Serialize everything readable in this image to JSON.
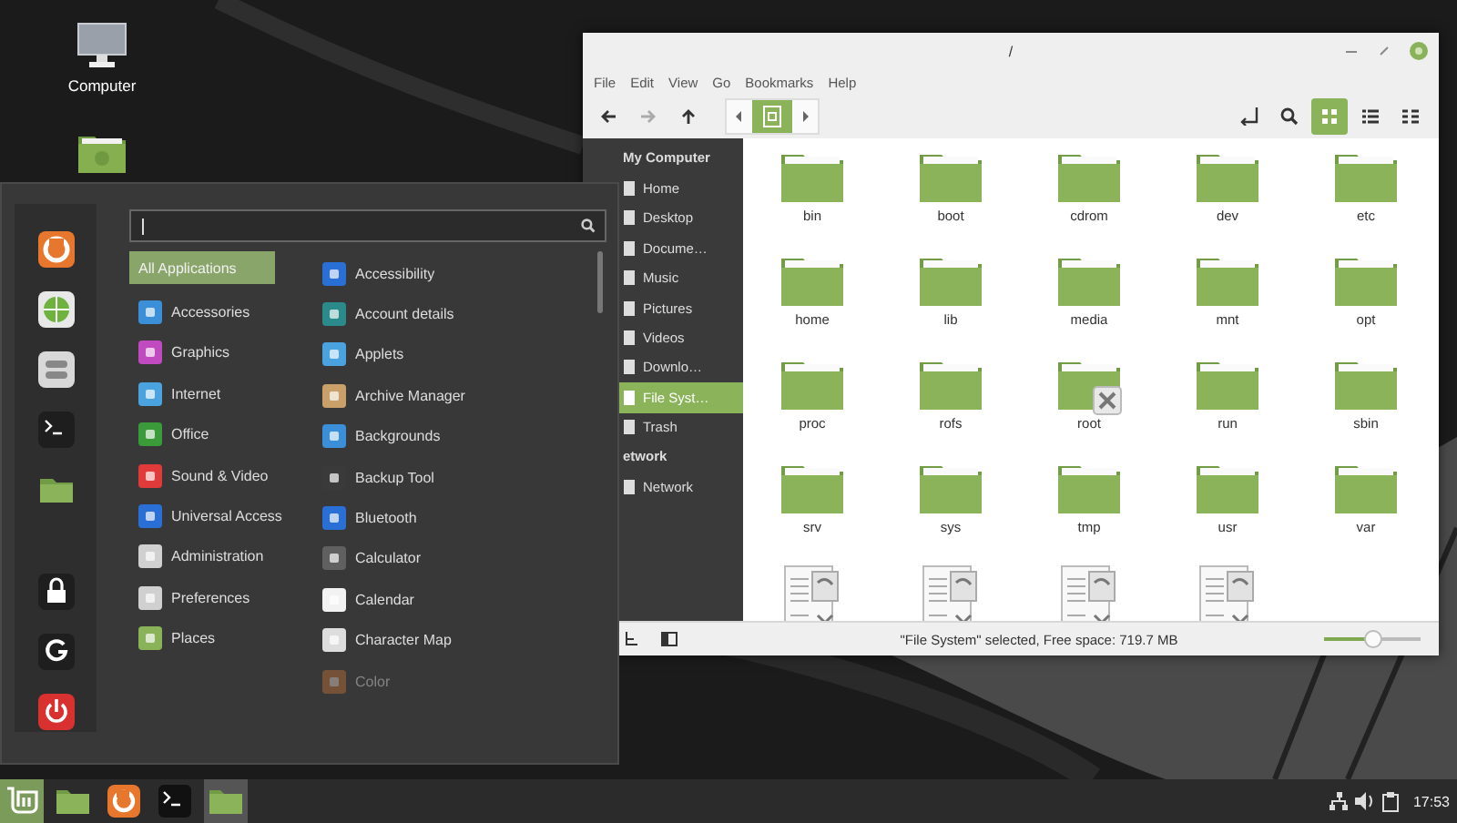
{
  "desktop_icons": [
    {
      "label": "Computer"
    }
  ],
  "file_manager": {
    "title": "/",
    "menu": [
      "File",
      "Edit",
      "View",
      "Go",
      "Bookmarks",
      "Help"
    ],
    "path_buttons": [
      {
        "selected": true
      }
    ],
    "view_modes": [
      {
        "selected": true
      },
      {
        "selected": false
      },
      {
        "selected": false
      }
    ],
    "sidebar": [
      {
        "heading": "My Computer",
        "items": [
          {
            "label": "Home",
            "selected": false
          },
          {
            "label": "Desktop",
            "selected": false
          },
          {
            "label": "Docume…",
            "selected": false
          },
          {
            "label": "Music",
            "selected": false
          },
          {
            "label": "Pictures",
            "selected": false
          },
          {
            "label": "Videos",
            "selected": false
          },
          {
            "label": "Downlo…",
            "selected": false
          },
          {
            "label": "File Syst…",
            "selected": true
          },
          {
            "label": "Trash",
            "selected": false
          }
        ]
      },
      {
        "heading": "etwork",
        "items": [
          {
            "label": "Network",
            "selected": false
          }
        ]
      }
    ],
    "files": [
      {
        "name": "bin",
        "kind": "folder",
        "locked": false
      },
      {
        "name": "boot",
        "kind": "folder",
        "locked": false
      },
      {
        "name": "cdrom",
        "kind": "folder",
        "locked": false
      },
      {
        "name": "dev",
        "kind": "folder",
        "locked": false
      },
      {
        "name": "etc",
        "kind": "folder",
        "locked": false
      },
      {
        "name": "home",
        "kind": "folder",
        "locked": false
      },
      {
        "name": "lib",
        "kind": "folder",
        "locked": false
      },
      {
        "name": "media",
        "kind": "folder",
        "locked": false
      },
      {
        "name": "mnt",
        "kind": "folder",
        "locked": false
      },
      {
        "name": "opt",
        "kind": "folder",
        "locked": false
      },
      {
        "name": "proc",
        "kind": "folder",
        "locked": false
      },
      {
        "name": "rofs",
        "kind": "folder",
        "locked": false
      },
      {
        "name": "root",
        "kind": "folder",
        "locked": true
      },
      {
        "name": "run",
        "kind": "folder",
        "locked": false
      },
      {
        "name": "sbin",
        "kind": "folder",
        "locked": false
      },
      {
        "name": "srv",
        "kind": "folder",
        "locked": false
      },
      {
        "name": "sys",
        "kind": "folder",
        "locked": false
      },
      {
        "name": "tmp",
        "kind": "folder",
        "locked": false
      },
      {
        "name": "usr",
        "kind": "folder",
        "locked": false
      },
      {
        "name": "var",
        "kind": "folder",
        "locked": false
      },
      {
        "kind": "document",
        "locked": false
      },
      {
        "kind": "document",
        "locked": false
      },
      {
        "kind": "document",
        "locked": false
      },
      {
        "kind": "document",
        "locked": false
      }
    ],
    "status_bar": {
      "text": "\"File System\" selected, Free space: 719.7 MB",
      "zoom": {
        "level": 0.5
      }
    }
  },
  "menu": {
    "categories": [
      {
        "label": "All Applications",
        "selected": true
      },
      {
        "label": "Accessories",
        "selected": false
      },
      {
        "label": "Graphics",
        "selected": false
      },
      {
        "label": "Internet",
        "selected": false
      },
      {
        "label": "Office",
        "selected": false
      },
      {
        "label": "Sound & Video",
        "selected": false
      },
      {
        "label": "Universal Access",
        "selected": false
      },
      {
        "label": "Administration",
        "selected": false
      },
      {
        "label": "Preferences",
        "selected": false
      },
      {
        "label": "Places",
        "selected": false
      }
    ],
    "apps": [
      {
        "label": "Accessibility",
        "faded": false
      },
      {
        "label": "Account details",
        "faded": false
      },
      {
        "label": "Applets",
        "faded": false
      },
      {
        "label": "Archive Manager",
        "faded": false
      },
      {
        "label": "Backgrounds",
        "faded": false
      },
      {
        "label": "Backup Tool",
        "faded": false
      },
      {
        "label": "Bluetooth",
        "faded": false
      },
      {
        "label": "Calculator",
        "faded": false
      },
      {
        "label": "Calendar",
        "faded": false
      },
      {
        "label": "Character Map",
        "faded": false
      },
      {
        "label": "Color",
        "faded": true
      }
    ]
  },
  "taskbar": {
    "items": [
      {
        "kind": "menu",
        "selected": true
      },
      {
        "kind": "folder",
        "selected": false
      },
      {
        "kind": "browser",
        "selected": false
      },
      {
        "kind": "terminal",
        "selected": false
      },
      {
        "kind": "folder",
        "selected": true
      }
    ],
    "clock": "17:53"
  }
}
